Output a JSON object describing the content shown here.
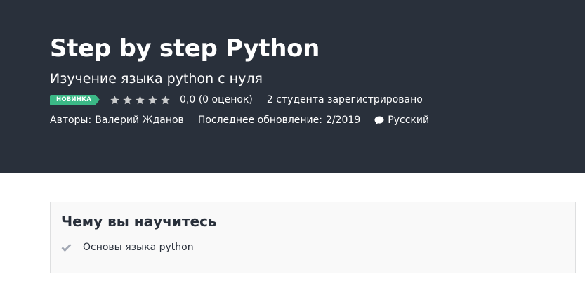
{
  "hero": {
    "title": "Step by step Python",
    "subtitle": "Изучение языка python с нуля",
    "badge": "НОВИНКА",
    "stars_icon": "star-icon",
    "star_count": 5,
    "rating_text": "0,0 (0 оценок)",
    "enrolled_text": "2 студента зарегистрировано",
    "authors_label": "Авторы:",
    "author_name": "Валерий Жданов",
    "updated_label": "Последнее обновление:",
    "updated_value": "2/2019",
    "language_icon": "speech-bubble-icon",
    "language": "Русский"
  },
  "learn": {
    "title": "Чему вы научитесь",
    "check_icon": "check-icon",
    "items": [
      "Основы языка python"
    ]
  },
  "colors": {
    "hero_bg": "#29303b",
    "badge_bg": "#3bb886",
    "box_bg": "#f9f9f9",
    "box_border": "#dedfe0"
  }
}
